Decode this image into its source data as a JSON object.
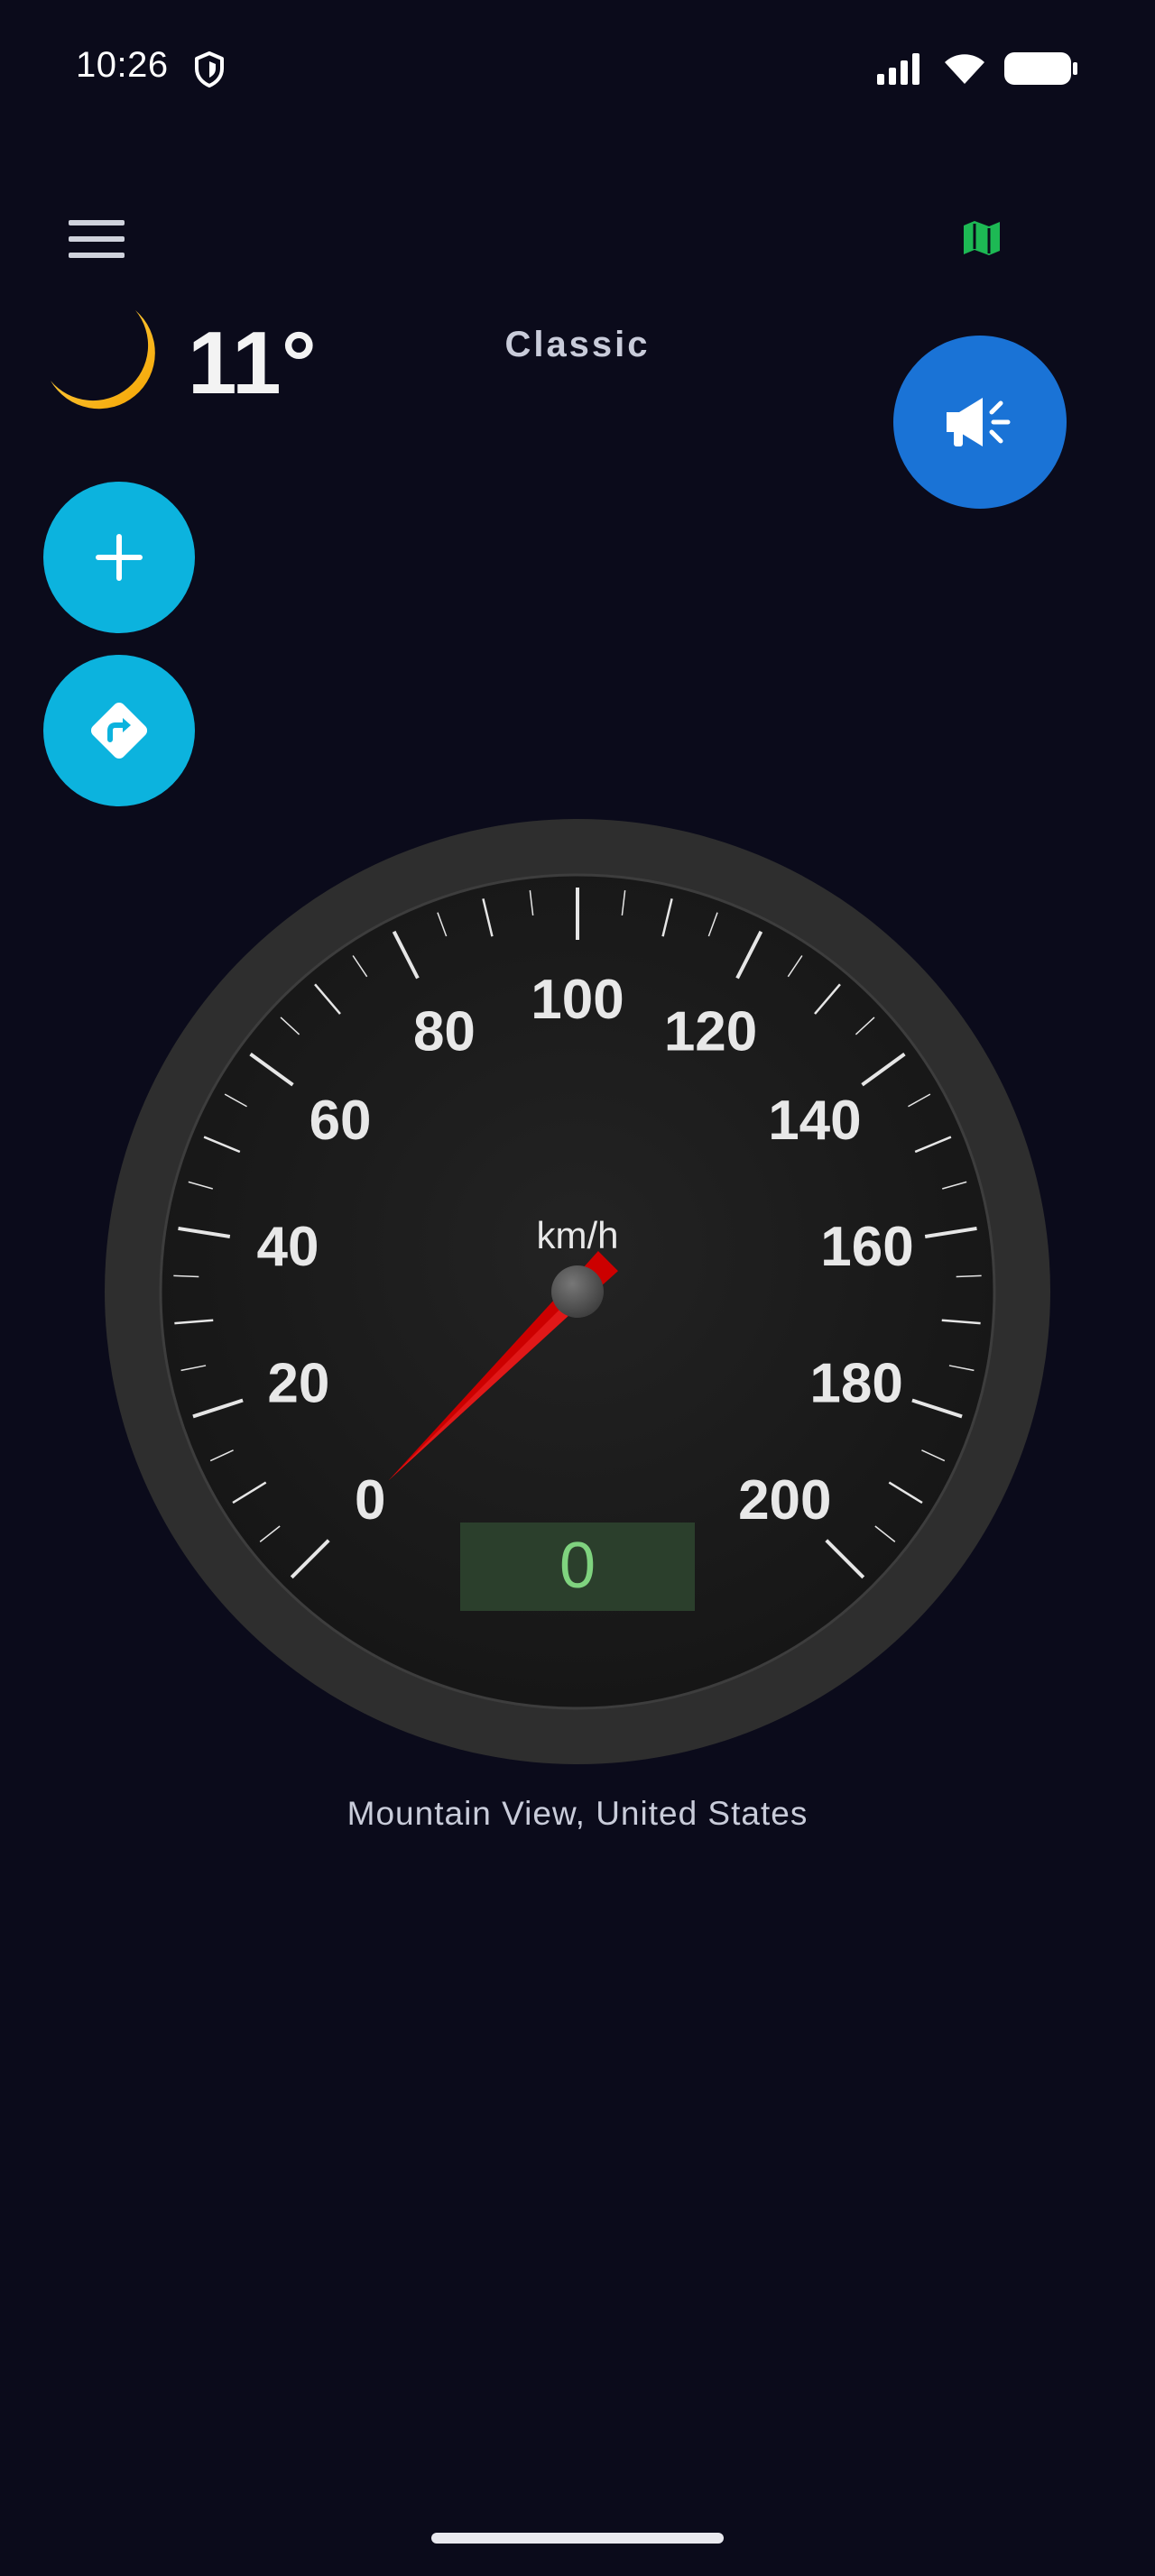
{
  "status_bar": {
    "time": "10:26",
    "icons": [
      "shield-icon",
      "signal-icon",
      "wifi-icon",
      "battery-icon"
    ]
  },
  "toolbar": {
    "menu_icon": "hamburger-menu-icon",
    "map_icon": "map-icon",
    "map_icon_color": "#1db954"
  },
  "weather": {
    "icon": "crescent-moon-icon",
    "temperature": "11°"
  },
  "speedometer_style": "Classic",
  "buttons": {
    "announce_icon": "megaphone-icon",
    "add_icon": "plus-icon",
    "route_icon": "turn-right-sign-icon"
  },
  "gauge": {
    "unit": "km/h",
    "tick_labels": [
      "0",
      "20",
      "40",
      "60",
      "80",
      "100",
      "120",
      "140",
      "160",
      "180",
      "200"
    ],
    "current_speed": "0",
    "needle_value": 0,
    "colors": {
      "bezel": "#2e2e2e",
      "face": "#1a1a1a",
      "needle": "#cc0000",
      "readout_bg": "#2b3f2c",
      "readout_text": "#7fd37f"
    }
  },
  "location": "Mountain View, United States"
}
